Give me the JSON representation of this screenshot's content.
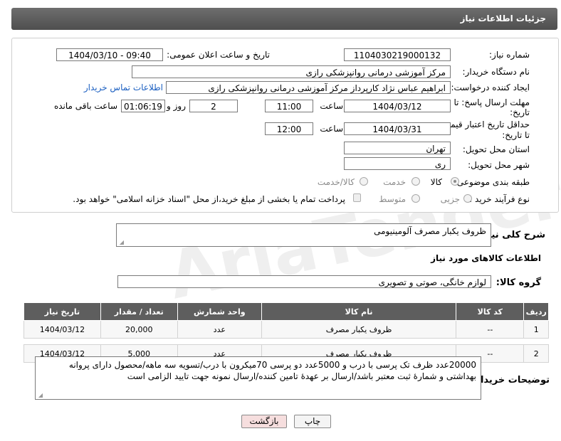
{
  "header": {
    "title": "جزئیات اطلاعات نیاز"
  },
  "form": {
    "need_number_label": "شماره نیاز:",
    "need_number": "1104030219000132",
    "announce_label": "تاریخ و ساعت اعلان عمومی:",
    "announce_value": "1404/03/10 - 09:40",
    "buyer_org_label": "نام دستگاه خریدار:",
    "buyer_org": "مرکز آموزشی درمانی روانپزشکی رازی",
    "creator_label": "ایجاد کننده درخواست:",
    "creator": "ابراهیم عباس نژاد کارپرداز مرکز آموزشی درمانی روانپزشکی رازی",
    "contact_link": "اطلاعات تماس خریدار",
    "deadline_label_1": "مهلت ارسال پاسخ: تا",
    "deadline_label_2": "تاریخ:",
    "deadline_date": "1404/03/12",
    "time_label": "ساعت",
    "deadline_time": "11:00",
    "days_value": "2",
    "days_label": "روز و",
    "remaining_time": "01:06:19",
    "remaining_label": "ساعت باقی مانده",
    "validity_label_1": "حداقل تاریخ اعتبار قیمت:",
    "validity_label_2": "تا تاریخ:",
    "validity_date": "1404/03/31",
    "validity_time": "12:00",
    "province_label": "استان محل تحویل:",
    "province": "تهران",
    "city_label": "شهر محل تحویل:",
    "city": "ری",
    "category_label": "طبقه بندی موضوعی:",
    "category_options": [
      "کالا",
      "خدمت",
      "کالا/خدمت"
    ],
    "process_label": "نوع فرآیند خرید :",
    "process_options": [
      "جزیی",
      "متوسط"
    ],
    "payment_note": "پرداخت تمام یا بخشی از مبلغ خرید،از محل \"اسناد خزانه اسلامی\" خواهد بود."
  },
  "summary": {
    "label": "شرح کلی نیاز:",
    "value": "ظروف یکبار مصرف آلومینیومی"
  },
  "items_section": {
    "title": "اطلاعات کالاهای مورد نیاز",
    "group_label": "گروه کالا:",
    "group_value": "لوازم خانگی، صوتی و تصویری"
  },
  "table": {
    "headers": [
      "ردیف",
      "کد کالا",
      "نام کالا",
      "واحد شمارش",
      "تعداد / مقدار",
      "تاریخ نیاز"
    ],
    "rows": [
      [
        "1",
        "--",
        "ظروف یکبار مصرف",
        "عدد",
        "20,000",
        "1404/03/12"
      ],
      [
        "2",
        "--",
        "ظروف یکبار مصرف",
        "عدد",
        "5,000",
        "1404/03/12"
      ]
    ]
  },
  "buyer_notes": {
    "label": "توضیحات خریدار:",
    "value": "20000عدد ظرف تک پرسی با درب و 5000عدد دو پرسی 70میکرون با درب/تسویه سه ماهه/محصول دارای پروانه بهداشتی و شمارۀ ثبت معتبر باشد/ارسال بر عهدۀ تامین کننده/ارسال نمونه جهت تایید الزامی است"
  },
  "buttons": {
    "print": "چاپ",
    "back": "بازگشت"
  },
  "watermark": "AriaTender.neT",
  "colors": {
    "header_bg": "#5a5a5a",
    "link": "#1b5fc1",
    "back_button_bg": "#f6dede"
  }
}
